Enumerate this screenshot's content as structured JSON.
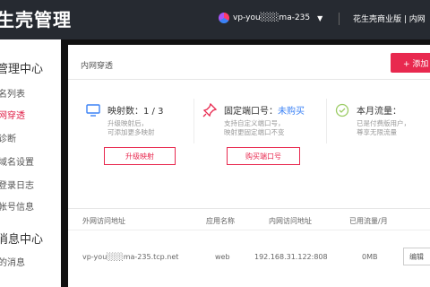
{
  "header": {
    "brand": "生壳管理",
    "account_name": "vp-you░░░ma-235",
    "edition": "花生壳商业版 | 内网"
  },
  "sidebar": {
    "section1": "管理中心",
    "items": [
      "名列表",
      "网穿透",
      "诊断",
      "域名设置",
      "登录日志",
      "帐号信息"
    ],
    "active_index": 1,
    "section2": "消息中心",
    "items2": [
      "的消息"
    ]
  },
  "main": {
    "section_title": "内网穿透",
    "add_button": "+ 添加"
  },
  "cards": [
    {
      "icon": "monitor-icon",
      "title": "映射数：1 / 3",
      "desc1": "升级映射后，",
      "desc2": "可添加更多映射",
      "button": "升级映射"
    },
    {
      "icon": "pin-icon",
      "title": "固定端口号：",
      "title_link": "未购买",
      "desc1": "支持自定义端口号，",
      "desc2": "映射更固定端口不变",
      "button": "购买端口号"
    },
    {
      "icon": "check-circle-icon",
      "title": "本月流量：",
      "desc1": "已是付费版用户，",
      "desc2": "尊享无限流量"
    }
  ],
  "table": {
    "headers": [
      "外网访问地址",
      "应用名称",
      "内网访问地址",
      "已用流量/月"
    ],
    "rows": [
      [
        "vp-you░░░ma-235.tcp.net",
        "web",
        "192.168.31.122:808",
        "0MB"
      ]
    ],
    "action": "编辑"
  },
  "colors": {
    "accent": "#e8294f",
    "link": "#3b82f6",
    "topbar": "#262a31"
  }
}
